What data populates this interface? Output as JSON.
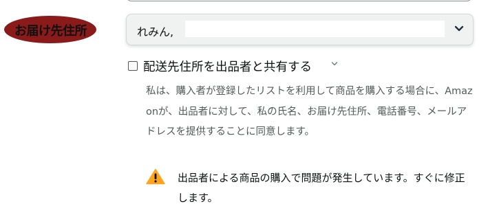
{
  "address_field": {
    "label": "お届け先住所",
    "selected_value": "れみん,",
    "chevron_icon": "chevron-down-icon"
  },
  "share_option": {
    "checked": false,
    "label": "配送先住所を出品者と共有する",
    "expand_icon": "chevron-down-icon",
    "description": "私は、購入者が登録したリストを利用して商品を購入する場合に、Amazonが、出品者に対して、私の氏名、お届け先住所、電話番号、メールアドレスを提供することに同意します。"
  },
  "warning": {
    "icon": "warning-triangle-icon",
    "text": "出品者による商品の購入で問題が発生しています。すぐに修正します。"
  },
  "colors": {
    "label_highlight": "#8b1a1a",
    "select_background": "#f0f2f2",
    "warning_yellow": "#ffa41c",
    "muted_text": "#565959"
  }
}
